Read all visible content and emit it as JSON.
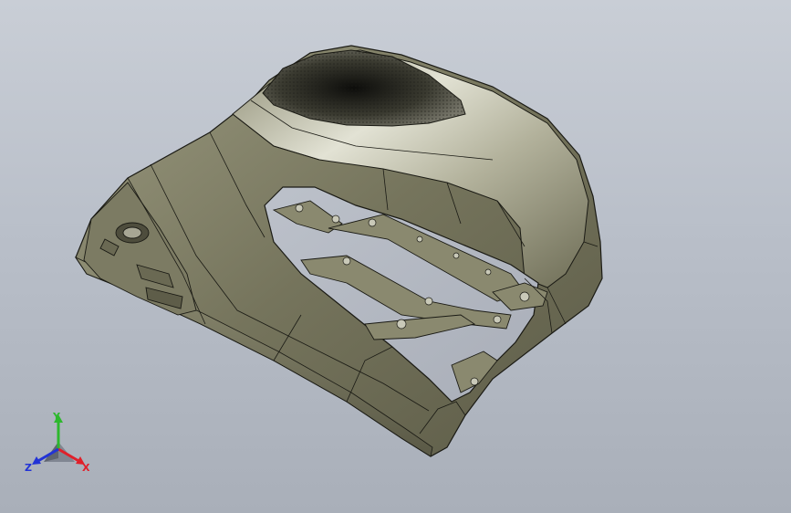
{
  "viewport": {
    "background_top": "#c9ced6",
    "background_bottom": "#a9afb9"
  },
  "model": {
    "icon": "cad-part-model",
    "body_color": "#7b7a62",
    "highlight_color": "#d6d6c6",
    "edge_color": "#1a1a14"
  },
  "triad": {
    "icon": "view-orientation-triad-icon",
    "x_label": "X",
    "y_label": "Y",
    "z_label": "Z",
    "x_color": "#e0202a",
    "y_color": "#2db82d",
    "z_color": "#2233d6"
  }
}
